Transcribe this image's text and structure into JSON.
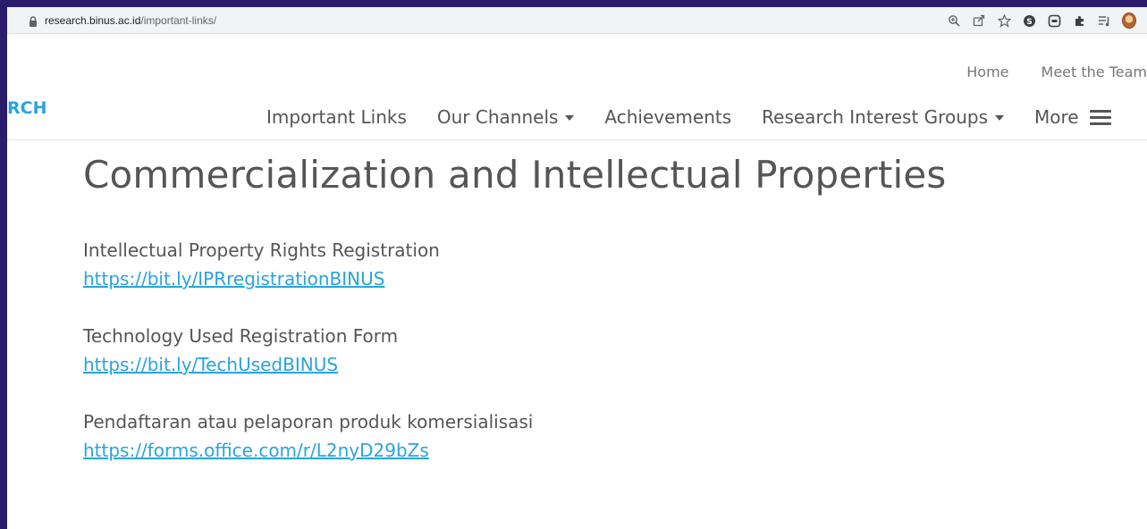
{
  "browser": {
    "url_host": "research.binus.ac.id",
    "url_path": "/important-links/"
  },
  "toolbar_icons": [
    "zoom-icon",
    "share-icon",
    "star-icon",
    "skype-icon",
    "extension-square-icon",
    "puzzle-icon",
    "media-queue-icon",
    "profile-avatar"
  ],
  "header": {
    "brand_fragment": "RCH",
    "top_nav": [
      "Home",
      "Meet the Team"
    ],
    "main_nav": [
      {
        "label": "Important Links",
        "has_caret": false
      },
      {
        "label": "Our Channels",
        "has_caret": true
      },
      {
        "label": "Achievements",
        "has_caret": false
      },
      {
        "label": "Research Interest Groups",
        "has_caret": true
      },
      {
        "label": "More",
        "has_caret": false
      }
    ]
  },
  "page": {
    "title": "Commercialization and Intellectual Properties",
    "links": [
      {
        "title": "Intellectual Property Rights Registration",
        "url": "https://bit.ly/IPRregistrationBINUS"
      },
      {
        "title": "Technology Used Registration Form",
        "url": "https://bit.ly/TechUsedBINUS"
      },
      {
        "title": "Pendaftaran atau pelaporan produk komersialisasi",
        "url": "https://forms.office.com/r/L2nyD29bZs"
      }
    ]
  },
  "colors": {
    "accent": "#2aa3dc",
    "text": "#555555",
    "outer_border": "#2b1c6b"
  }
}
